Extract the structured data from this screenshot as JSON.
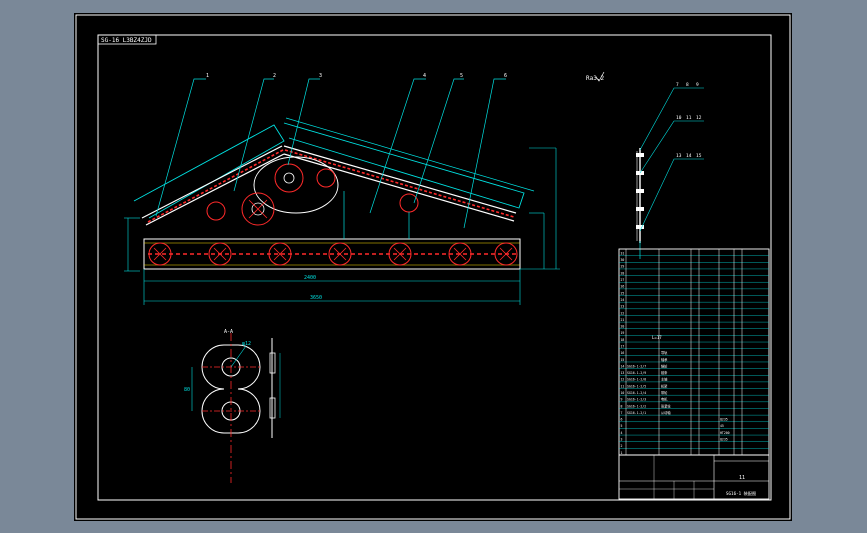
{
  "drawing": {
    "frame_tag": "SG-16 L3BZ4ZJD",
    "detail_label": "A-A",
    "scale_note": "Ra3.2",
    "balloons_main": [
      "1",
      "2",
      "3",
      "4",
      "5",
      "6"
    ],
    "balloons_side_top": [
      "7",
      "8",
      "9"
    ],
    "balloons_side_mid": [
      "10",
      "11",
      "12"
    ],
    "balloons_side_low": [
      "13",
      "14",
      "15"
    ],
    "dims_bottom": [
      "2400",
      "3650"
    ],
    "dims_detail": [
      "φ12",
      "80"
    ]
  },
  "bom": {
    "row_numbers": [
      "31",
      "30",
      "29",
      "28",
      "27",
      "26",
      "25",
      "24",
      "23",
      "22",
      "21",
      "20",
      "19",
      "18",
      "17",
      "16",
      "15",
      "14",
      "13",
      "12",
      "11",
      "10",
      "9",
      "8",
      "7",
      "6",
      "5",
      "4",
      "3",
      "2",
      "1"
    ],
    "mid_note": "L=17",
    "part_codes": [
      "SG16-1-2/7",
      "SG16-1-2/9",
      "SG16-1-2/8",
      "SG16-1-2/5",
      "SG16-1-2/4",
      "SG16-1-2/3",
      "SG16-1-2/2",
      "SG16-1-2/1"
    ],
    "part_names": [
      "导轨",
      "轴承",
      "链轮",
      "链条",
      "主轴",
      "机架",
      "带轮",
      "电机",
      "张紧轮",
      "从动轴"
    ],
    "materials": [
      "Q235",
      "45",
      "HT200",
      "Q235"
    ],
    "title_small": "11",
    "title_name": "SG16-1 装配图"
  },
  "colors": {
    "line_red": "#ff2a2a",
    "line_white": "#ffffff",
    "line_cyan": "#00e0e0",
    "line_yellow": "#ffe000",
    "canvas": "#000000",
    "page": "#7a8898"
  }
}
